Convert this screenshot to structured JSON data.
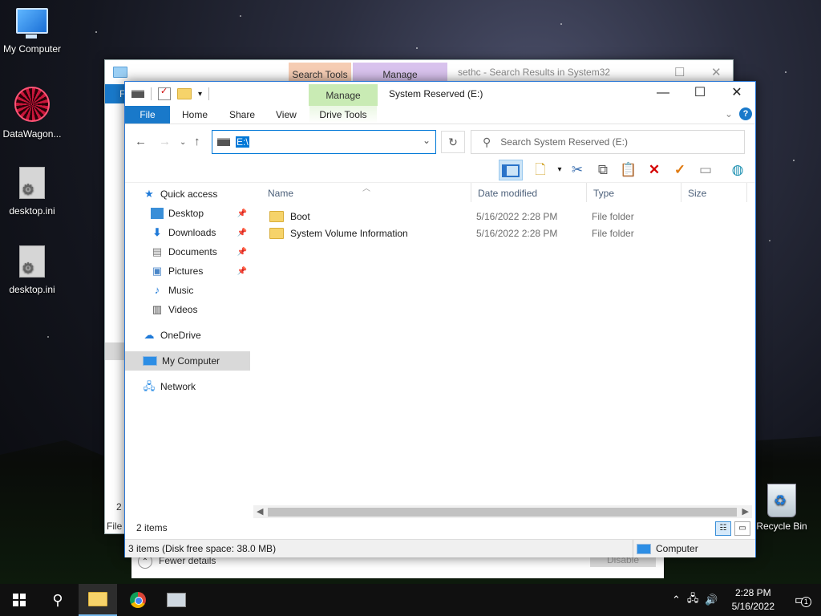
{
  "desktop": {
    "icons": [
      {
        "label": "My Computer",
        "icon": "computer-icon"
      },
      {
        "label": "DataWagon...",
        "icon": "app-shortcut-icon"
      },
      {
        "label": "desktop.ini",
        "icon": "config-file-icon"
      },
      {
        "label": "desktop.ini",
        "icon": "config-file-icon"
      },
      {
        "label": "Recycle Bin",
        "icon": "recycle-bin-icon"
      }
    ]
  },
  "background_window": {
    "ctx_tab_1": "Search Tools",
    "ctx_tab_2": "Manage",
    "title": "sethc - Search Results in System32",
    "left_file": "F",
    "status_count": "2 i",
    "status_file": "File d"
  },
  "details_pane": {
    "fewer": "Fewer details",
    "disable": "Disable"
  },
  "window": {
    "title": "System Reserved (E:)",
    "manage_tab": "Manage",
    "ribbon_tabs": [
      "File",
      "Home",
      "Share",
      "View",
      "Drive Tools"
    ],
    "address": "E:\\",
    "search_placeholder": "Search System Reserved (E:)",
    "nav": {
      "quick_access": "Quick access",
      "items": [
        {
          "label": "Desktop",
          "pinned": true
        },
        {
          "label": "Downloads",
          "pinned": true
        },
        {
          "label": "Documents",
          "pinned": true
        },
        {
          "label": "Pictures",
          "pinned": true
        },
        {
          "label": "Music",
          "pinned": false
        },
        {
          "label": "Videos",
          "pinned": false
        }
      ],
      "onedrive": "OneDrive",
      "my_computer": "My Computer",
      "network": "Network"
    },
    "columns": [
      "Name",
      "Date modified",
      "Type",
      "Size"
    ],
    "files": [
      {
        "name": "Boot",
        "date": "5/16/2022 2:28 PM",
        "type": "File folder",
        "size": ""
      },
      {
        "name": "System Volume Information",
        "date": "5/16/2022 2:28 PM",
        "type": "File folder",
        "size": ""
      }
    ],
    "status_items": "2 items",
    "bottom_status": "3 items (Disk free space: 38.0 MB)",
    "bottom_location": "Computer"
  },
  "taskbar": {
    "time": "2:28 PM",
    "date": "5/16/2022",
    "notification_count": "1"
  },
  "colors": {
    "accent": "#0078d7",
    "file_tab": "#1979ca",
    "manage_tab": "#c9ebb4",
    "search_tools_tab": "#f6cdb4",
    "bg_manage_tab": "#d9c3ee"
  }
}
